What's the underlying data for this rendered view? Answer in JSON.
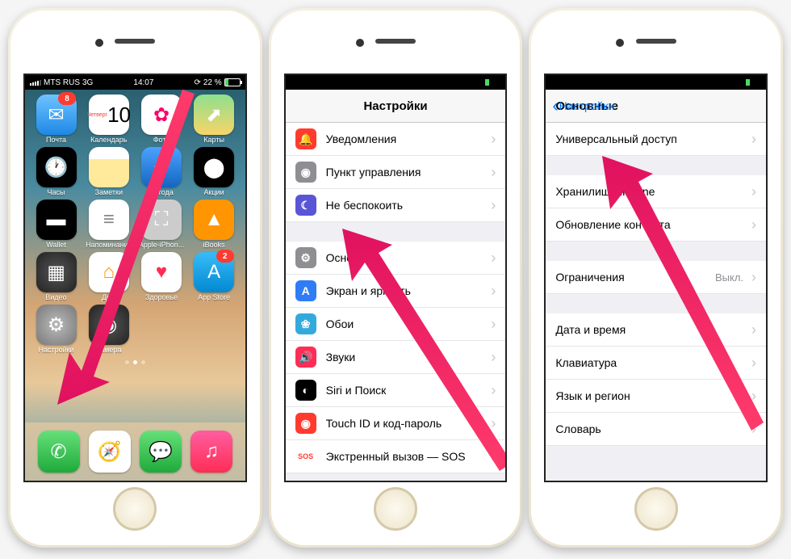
{
  "status": {
    "carrier": "MTS RUS",
    "net": "3G",
    "time": "14:07",
    "battery": "22 %"
  },
  "home": {
    "apps": [
      {
        "name": "Почта",
        "color": "linear-gradient(#6fc3ff,#1e88e5)",
        "glyph": "✉",
        "badge": "8"
      },
      {
        "name": "Календарь",
        "cal": true,
        "day": "Четверг",
        "date": "10"
      },
      {
        "name": "Фото",
        "color": "#fff",
        "glyph": "✿",
        "fg": "#f06"
      },
      {
        "name": "Карты",
        "color": "linear-gradient(#8ee08e,#f8d568)",
        "glyph": "⬈"
      },
      {
        "name": "Часы",
        "color": "#000",
        "glyph": "🕐"
      },
      {
        "name": "Заметки",
        "color": "linear-gradient(#fff 30%,#ffe99a 30%)",
        "glyph": ""
      },
      {
        "name": "Погода",
        "color": "linear-gradient(#4aa3ff,#1565c0)",
        "glyph": "☀"
      },
      {
        "name": "Акции",
        "color": "#000",
        "glyph": "⬤",
        "fg": "#fff"
      },
      {
        "name": "Wallet",
        "color": "#000",
        "glyph": "▬"
      },
      {
        "name": "Напоминания",
        "color": "#fff",
        "glyph": "≡",
        "fg": "#888"
      },
      {
        "name": "Apple-iPhon...",
        "color": "#ccc",
        "glyph": "⛶"
      },
      {
        "name": "iBooks",
        "color": "#ff9500",
        "glyph": "▲"
      },
      {
        "name": "Видео",
        "color": "radial-gradient(#555,#222)",
        "glyph": "▦"
      },
      {
        "name": "Дом",
        "color": "#fff",
        "glyph": "⌂",
        "fg": "#ff9500"
      },
      {
        "name": "Здоровье",
        "color": "#fff",
        "glyph": "♥",
        "fg": "#ff2d55"
      },
      {
        "name": "App Store",
        "color": "linear-gradient(#38bdf8,#0288d1)",
        "glyph": "A",
        "badge": "2"
      },
      {
        "name": "Настройки",
        "color": "radial-gradient(#bbb,#777)",
        "glyph": "⚙"
      },
      {
        "name": "Камера",
        "color": "radial-gradient(#555,#222)",
        "glyph": "◉"
      }
    ],
    "dock": [
      {
        "name": "Телефон",
        "color": "linear-gradient(#66e07a,#1faa3a)",
        "glyph": "✆"
      },
      {
        "name": "Safari",
        "color": "#fff",
        "glyph": "🧭",
        "fg": "#1e88e5"
      },
      {
        "name": "Сообщения",
        "color": "linear-gradient(#66e07a,#1faa3a)",
        "glyph": "💬"
      },
      {
        "name": "Музыка",
        "color": "linear-gradient(#ff5ea0,#ff2d55)",
        "glyph": "♫"
      }
    ]
  },
  "settings": {
    "title": "Настройки",
    "rows": [
      {
        "icon": "🔔",
        "bg": "#ff3b30",
        "label": "Уведомления"
      },
      {
        "icon": "◉",
        "bg": "#8e8e93",
        "label": "Пункт управления"
      },
      {
        "icon": "☾",
        "bg": "#5856d6",
        "label": "Не беспокоить"
      },
      {
        "gap": true
      },
      {
        "icon": "⚙",
        "bg": "#8e8e93",
        "label": "Основные"
      },
      {
        "icon": "A",
        "bg": "#2f7cf6",
        "label": "Экран и яркость"
      },
      {
        "icon": "❀",
        "bg": "#34aadc",
        "label": "Обои"
      },
      {
        "icon": "🔊",
        "bg": "#ff2d55",
        "label": "Звуки"
      },
      {
        "icon": "◐",
        "bg": "#000",
        "label": "Siri и Поиск"
      },
      {
        "icon": "◉",
        "bg": "#ff3b30",
        "label": "Touch ID и код-пароль"
      },
      {
        "icon": "SOS",
        "bg": "#fff",
        "fg": "#ff3b30",
        "label": "Экстренный вызов — SOS"
      }
    ]
  },
  "general": {
    "back": "Настройки",
    "title": "Основные",
    "rows": [
      {
        "label": "Универсальный доступ"
      },
      {
        "gap": true
      },
      {
        "label": "Хранилище iPhone"
      },
      {
        "label": "Обновление контента"
      },
      {
        "gap": true
      },
      {
        "label": "Ограничения",
        "value": "Выкл."
      },
      {
        "gap": true
      },
      {
        "label": "Дата и время"
      },
      {
        "label": "Клавиатура"
      },
      {
        "label": "Язык и регион"
      },
      {
        "label": "Словарь"
      },
      {
        "gap": true
      }
    ]
  }
}
